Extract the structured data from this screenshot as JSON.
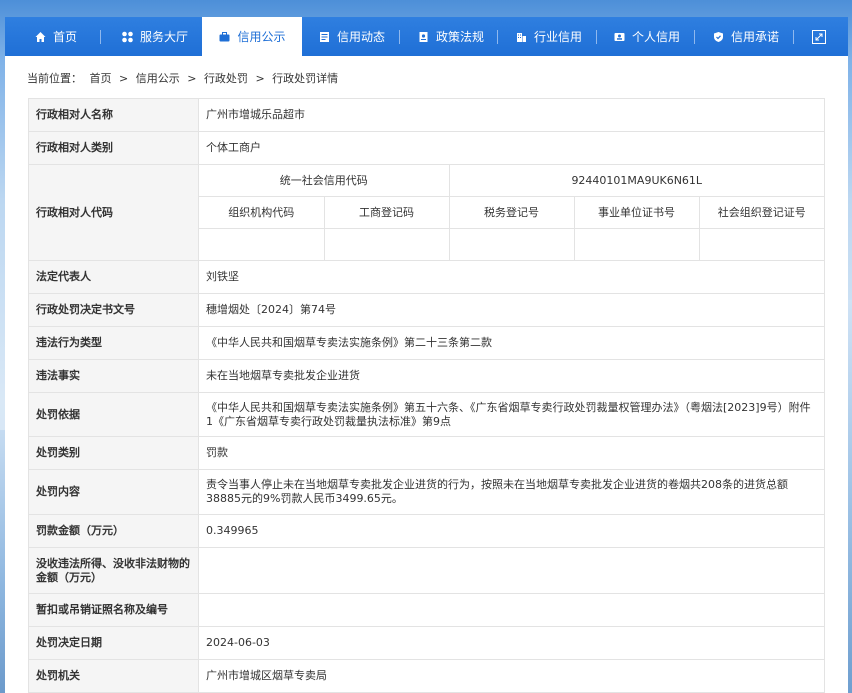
{
  "nav": {
    "items": [
      {
        "label": "首页",
        "icon": "home-icon"
      },
      {
        "label": "服务大厅",
        "icon": "grid-icon"
      },
      {
        "label": "信用公示",
        "icon": "briefcase-icon"
      },
      {
        "label": "信用动态",
        "icon": "news-icon"
      },
      {
        "label": "政策法规",
        "icon": "document-icon"
      },
      {
        "label": "行业信用",
        "icon": "building-icon"
      },
      {
        "label": "个人信用",
        "icon": "id-card-icon"
      },
      {
        "label": "信用承诺",
        "icon": "shield-check-icon"
      }
    ],
    "active_index": 2,
    "extra_icon": "expand-icon",
    "accent": "#1f6fd6"
  },
  "breadcrumb": {
    "prefix": "当前位置：",
    "items": [
      "首页",
      "信用公示",
      "行政处罚",
      "行政处罚详情"
    ],
    "separator": ">"
  },
  "detail": {
    "subject_name_label": "行政相对人名称",
    "subject_name": "广州市增城乐品超市",
    "subject_type_label": "行政相对人类别",
    "subject_type": "个体工商户",
    "subject_code_label": "行政相对人代码",
    "uscc_label": "统一社会信用代码",
    "uscc": "92440101MA9UK6N61L",
    "code_headers": [
      "组织机构代码",
      "工商登记码",
      "税务登记号",
      "事业单位证书号",
      "社会组织登记证号"
    ],
    "legal_rep_label": "法定代表人",
    "legal_rep": "刘铁坚",
    "doc_no_label": "行政处罚决定书文号",
    "doc_no": "穗增烟处〔2024〕第74号",
    "violation_type_label": "违法行为类型",
    "violation_type": "《中华人民共和国烟草专卖法实施条例》第二十三条第二款",
    "violation_fact_label": "违法事实",
    "violation_fact": "未在当地烟草专卖批发企业进货",
    "basis_label": "处罚依据",
    "basis": "《中华人民共和国烟草专卖法实施条例》第五十六条、《广东省烟草专卖行政处罚裁量权管理办法》（粤烟法[2023]9号）附件1《广东省烟草专卖行政处罚裁量执法标准》第9点",
    "category_label": "处罚类别",
    "category": "罚款",
    "content_label": "处罚内容",
    "content": "责令当事人停止未在当地烟草专卖批发企业进货的行为，按照未在当地烟草专卖批发企业进货的卷烟共208条的进货总额38885元的9%罚款人民币3499.65元。",
    "fine_label": "罚款金额（万元）",
    "fine": "0.349965",
    "confiscation_label": "没收违法所得、没收非法财物的金额（万元）",
    "confiscation": "",
    "license_label": "暂扣或吊销证照名称及编号",
    "license": "",
    "decision_date_label": "处罚决定日期",
    "decision_date": "2024-06-03",
    "authority_label": "处罚机关",
    "authority": "广州市增城区烟草专卖局"
  }
}
